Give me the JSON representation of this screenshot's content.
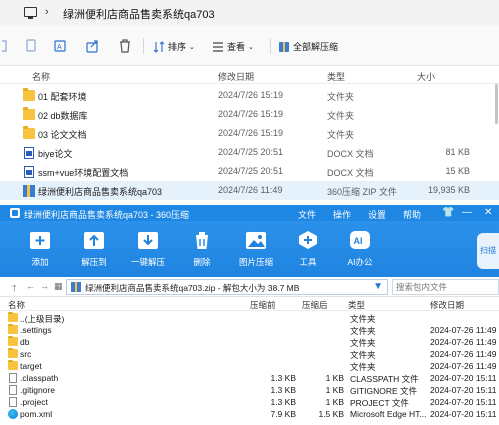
{
  "explorer": {
    "title_path": "绿洲便利店商品售卖系统qa703",
    "toolbar": {
      "sort_label": "排序",
      "view_label": "查看",
      "extract_all_label": "全部解压缩"
    },
    "columns": {
      "name": "名称",
      "modified": "修改日期",
      "type": "类型",
      "size": "大小"
    },
    "rows": [
      {
        "icon": "folder-icon",
        "name": "01 配套环境",
        "modified": "2024/7/26 15:19",
        "type": "文件夹",
        "size": ""
      },
      {
        "icon": "folder-icon",
        "name": "02 db数据库",
        "modified": "2024/7/26 15:19",
        "type": "文件夹",
        "size": ""
      },
      {
        "icon": "folder-icon",
        "name": "03 论文文档",
        "modified": "2024/7/26 15:19",
        "type": "文件夹",
        "size": ""
      },
      {
        "icon": "docx-icon",
        "name": "biye论文",
        "modified": "2024/7/25 20:51",
        "type": "DOCX 文档",
        "size": "81 KB"
      },
      {
        "icon": "docx-icon",
        "name": "ssm+vue环境配置文档",
        "modified": "2024/7/25 20:51",
        "type": "DOCX 文档",
        "size": "15 KB"
      },
      {
        "icon": "zip-icon",
        "name": "绿洲便利店商品售卖系统qa703",
        "modified": "2024/7/26 11:49",
        "type": "360压缩 ZIP 文件",
        "size": "19,935 KB"
      }
    ]
  },
  "zipwin": {
    "title": "绿洲便利店商品售卖系统qa703 - 360压缩",
    "menu": [
      "文件",
      "操作",
      "设置",
      "帮助"
    ],
    "ribbon": [
      {
        "label": "添加",
        "icon": "add-icon"
      },
      {
        "label": "解压到",
        "icon": "extract-to-icon"
      },
      {
        "label": "一键解压",
        "icon": "one-click-extract-icon"
      },
      {
        "label": "删除",
        "icon": "delete-icon"
      },
      {
        "label": "图片压缩",
        "icon": "image-compress-icon"
      },
      {
        "label": "工具",
        "icon": "tools-icon"
      },
      {
        "label": "AI办公",
        "icon": "ai-office-icon"
      }
    ],
    "scan_label": "扫描",
    "address": "绿洲便利店商品售卖系统qa703.zip - 解包大小为 38.7 MB",
    "search_placeholder": "搜索包内文件",
    "columns": {
      "name": "名称",
      "size": "压缩前",
      "packed": "压缩后",
      "type": "类型",
      "modified": "修改日期"
    },
    "rows": [
      {
        "icon": "folder-icon",
        "name": "..(上级目录)",
        "size": "",
        "packed": "",
        "type": "文件夹",
        "modified": ""
      },
      {
        "icon": "folder-icon",
        "name": ".settings",
        "size": "",
        "packed": "",
        "type": "文件夹",
        "modified": "2024-07-26 11:49"
      },
      {
        "icon": "folder-icon",
        "name": "db",
        "size": "",
        "packed": "",
        "type": "文件夹",
        "modified": "2024-07-26 11:49"
      },
      {
        "icon": "folder-icon",
        "name": "src",
        "size": "",
        "packed": "",
        "type": "文件夹",
        "modified": "2024-07-26 11:49"
      },
      {
        "icon": "folder-icon",
        "name": "target",
        "size": "",
        "packed": "",
        "type": "文件夹",
        "modified": "2024-07-26 11:49"
      },
      {
        "icon": "file-icon",
        "name": ".classpath",
        "size": "1.3 KB",
        "packed": "1 KB",
        "type": "CLASSPATH 文件",
        "modified": "2024-07-20 15:11"
      },
      {
        "icon": "file-icon",
        "name": ".gitignore",
        "size": "1.3 KB",
        "packed": "1 KB",
        "type": "GITIGNORE 文件",
        "modified": "2024-07-20 15:11"
      },
      {
        "icon": "file-icon",
        "name": ".project",
        "size": "1.3 KB",
        "packed": "1 KB",
        "type": "PROJECT 文件",
        "modified": "2024-07-20 15:11"
      },
      {
        "icon": "edge-icon",
        "name": "pom.xml",
        "size": "7.9 KB",
        "packed": "1.5 KB",
        "type": "Microsoft Edge HT...",
        "modified": "2024-07-20 15:11"
      }
    ]
  }
}
